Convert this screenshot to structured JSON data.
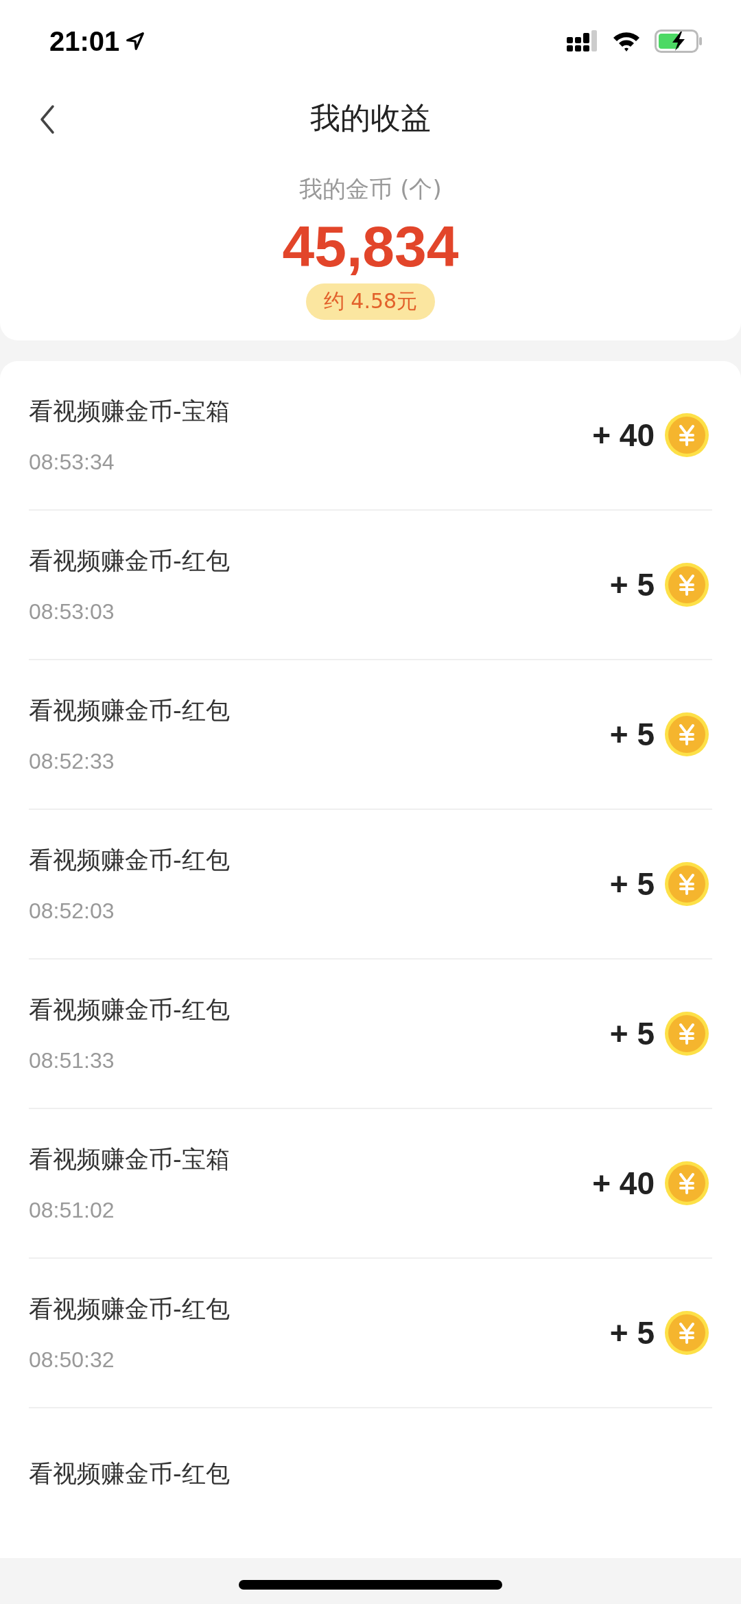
{
  "status_bar": {
    "time": "21:01"
  },
  "header": {
    "title": "我的收益"
  },
  "summary": {
    "label": "我的金币 (个)",
    "value": "45,834",
    "approx": "约 4.58元"
  },
  "records": [
    {
      "title": "看视频赚金币-宝箱",
      "time": "08:53:34",
      "amount": "+ 40"
    },
    {
      "title": "看视频赚金币-红包",
      "time": "08:53:03",
      "amount": "+ 5"
    },
    {
      "title": "看视频赚金币-红包",
      "time": "08:52:33",
      "amount": "+ 5"
    },
    {
      "title": "看视频赚金币-红包",
      "time": "08:52:03",
      "amount": "+ 5"
    },
    {
      "title": "看视频赚金币-红包",
      "time": "08:51:33",
      "amount": "+ 5"
    },
    {
      "title": "看视频赚金币-宝箱",
      "time": "08:51:02",
      "amount": "+ 40"
    },
    {
      "title": "看视频赚金币-红包",
      "time": "08:50:32",
      "amount": "+ 5"
    },
    {
      "title": "看视频赚金币-红包"
    }
  ]
}
